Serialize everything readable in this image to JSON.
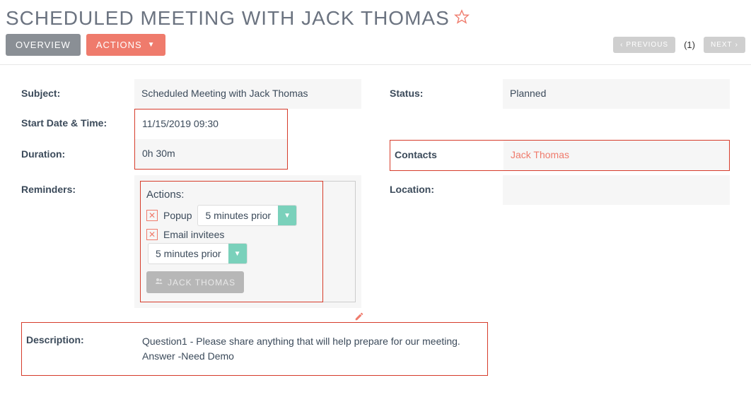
{
  "header": {
    "title": "SCHEDULED MEETING WITH JACK THOMAS"
  },
  "toolbar": {
    "overview_label": "OVERVIEW",
    "actions_label": "ACTIONS",
    "previous_label": "PREVIOUS",
    "next_label": "NEXT",
    "count_display": "(1)"
  },
  "fields": {
    "subject_label": "Subject:",
    "subject_value": "Scheduled Meeting with Jack Thomas",
    "status_label": "Status:",
    "status_value": "Planned",
    "startdate_label": "Start Date & Time:",
    "startdate_value": "11/15/2019 09:30",
    "duration_label": "Duration:",
    "duration_value": "0h 30m",
    "contacts_label": "Contacts",
    "contacts_value": "Jack Thomas",
    "location_label": "Location:",
    "location_value": "",
    "reminders_label": "Reminders:",
    "description_label": "Description:",
    "description_line1": "Question1 - Please share anything that will help prepare for our meeting.",
    "description_line2": "Answer -Need Demo"
  },
  "reminders": {
    "heading": "Actions:",
    "popup_label": "Popup",
    "popup_value": "5 minutes prior",
    "email_label": "Email invitees",
    "email_value": "5 minutes prior",
    "invitee_chip": "JACK THOMAS"
  },
  "colors": {
    "accent": "#ef7b6c",
    "secondary": "#7ad1bb",
    "highlight_border": "#d63c2b"
  }
}
